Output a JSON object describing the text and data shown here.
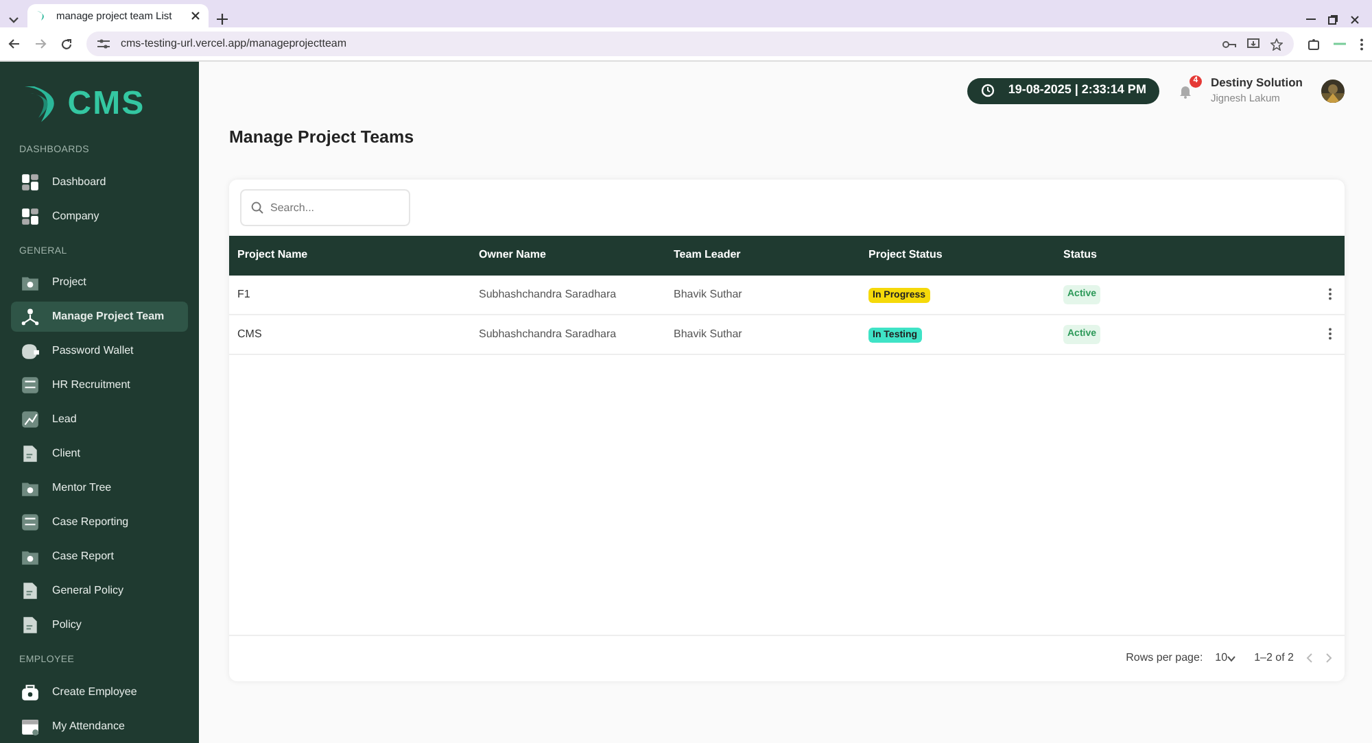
{
  "browser": {
    "tab_title": "manage project team List",
    "url": "cms-testing-url.vercel.app/manageprojectteam"
  },
  "sidebar": {
    "logo": "CMS",
    "sections": [
      {
        "title": "DASHBOARDS",
        "items": [
          {
            "label": "Dashboard",
            "kind": "grid",
            "selected": false
          },
          {
            "label": "Company",
            "kind": "grid",
            "selected": false
          }
        ]
      },
      {
        "title": "GENERAL",
        "items": [
          {
            "label": "Project",
            "kind": "folder",
            "selected": false
          },
          {
            "label": "Manage Project Team",
            "kind": "team",
            "selected": true
          },
          {
            "label": "Password Wallet",
            "kind": "wallet",
            "selected": false
          },
          {
            "label": "HR Recruitment",
            "kind": "checklist",
            "selected": false
          },
          {
            "label": "Lead",
            "kind": "chart",
            "selected": false
          },
          {
            "label": "Client",
            "kind": "doc",
            "selected": false
          },
          {
            "label": "Mentor Tree",
            "kind": "folder",
            "selected": false
          },
          {
            "label": "Case Reporting",
            "kind": "checklist",
            "selected": false
          },
          {
            "label": "Case Report",
            "kind": "folder",
            "selected": false
          },
          {
            "label": "General Policy",
            "kind": "doc",
            "selected": false
          },
          {
            "label": "Policy",
            "kind": "doc",
            "selected": false
          }
        ]
      },
      {
        "title": "EMPLOYEE",
        "items": [
          {
            "label": "Create Employee",
            "kind": "briefcase",
            "selected": false
          },
          {
            "label": "My Attendance",
            "kind": "calendar",
            "selected": false
          }
        ]
      }
    ]
  },
  "header": {
    "datetime": "19-08-2025 | 2:33:14 PM",
    "notification_count": "4",
    "company": "Destiny Solution",
    "user": "Jignesh Lakum"
  },
  "page_title": "Manage Project Teams",
  "search": {
    "placeholder": "Search..."
  },
  "table": {
    "columns": [
      "Project Name",
      "Owner Name",
      "Team Leader",
      "Project Status",
      "Status"
    ],
    "rows": [
      {
        "project": "F1",
        "owner": "Subhashchandra Saradhara",
        "leader": "Bhavik Suthar",
        "project_status": {
          "text": "In Progress",
          "color": "#f5d90a"
        },
        "status": "Active"
      },
      {
        "project": "CMS",
        "owner": "Subhashchandra Saradhara",
        "leader": "Bhavik Suthar",
        "project_status": {
          "text": "In Testing",
          "color": "#3fe3c6"
        },
        "status": "Active"
      }
    ]
  },
  "pagination": {
    "rows_per_page_label": "Rows per page:",
    "rows_per_page": "10",
    "range": "1–2 of 2"
  }
}
